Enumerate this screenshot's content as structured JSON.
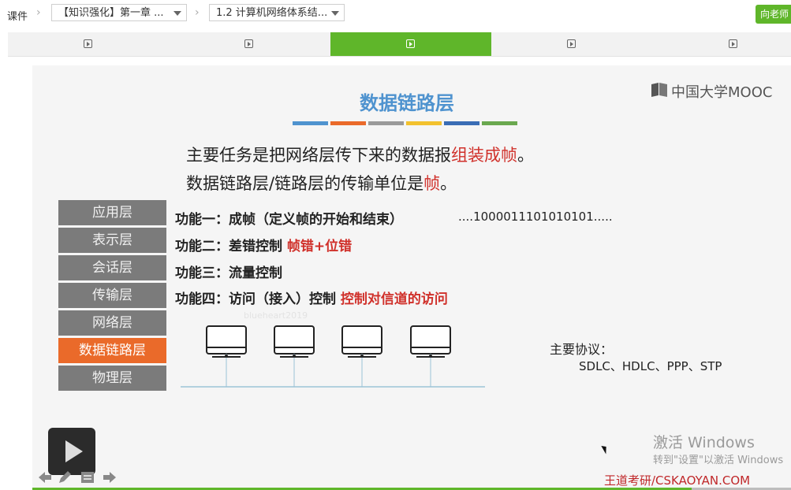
{
  "breadcrumb": {
    "root": "课件",
    "chapter": "【知识强化】第一章 ...",
    "section": "1.2 计算机网络体系结..."
  },
  "teacher_button": "向老师",
  "tabs": [
    {
      "icon": "video-icon",
      "active": false
    },
    {
      "icon": "video-icon",
      "active": false
    },
    {
      "icon": "video-icon",
      "active": true
    },
    {
      "icon": "video-icon",
      "active": false
    },
    {
      "icon": "video-icon",
      "active": false
    }
  ],
  "slide": {
    "title": "数据链路层",
    "brand": "中国大学MOOC",
    "title_bar_colors": [
      "#4f93cf",
      "#ea6a2a",
      "#9a9a9a",
      "#f2c12e",
      "#3a6db5",
      "#6aa84f"
    ],
    "line1_pre": "主要任务是把网络层传下来的数据报",
    "line1_red": "组装成帧",
    "line1_post": "。",
    "line2_pre": "数据链路层/链路层的传输单位是",
    "line2_red": "帧",
    "line2_post": "。",
    "layers": [
      "应用层",
      "表示层",
      "会话层",
      "传输层",
      "网络层",
      "数据链路层",
      "物理层"
    ],
    "active_layer": "数据链路层",
    "functions": [
      {
        "label": "功能一：成帧（定义帧的开始和结束）",
        "red": ""
      },
      {
        "label": "功能二：差错控制",
        "red": "帧错+位错"
      },
      {
        "label": "功能三：流量控制",
        "red": ""
      },
      {
        "label": "功能四：访问（接入）控制",
        "red": "控制对信道的访问"
      }
    ],
    "bit_stream": "....1000011101010101.....",
    "protocols_title": "主要协议：",
    "protocols": "SDLC、HDLC、PPP、STP",
    "faint_watermark": "blueheart2019",
    "windows_activate_title": "激活 Windows",
    "windows_activate_sub": "转到\"设置\"以激活 Windows",
    "footer_brand": "王道考研/CSKAOYAN.COM"
  },
  "accent_color": "#5fb62a"
}
